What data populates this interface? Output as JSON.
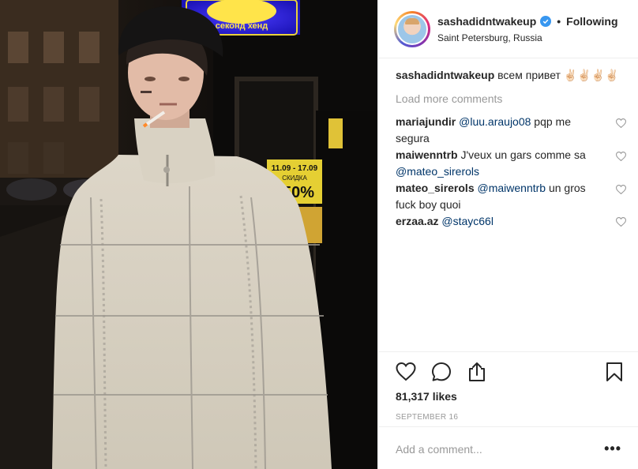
{
  "post": {
    "username": "sashadidntwakeup",
    "verified": true,
    "follow_status": "Following",
    "location": "Saint Petersburg, Russia",
    "caption_text": "всем привет",
    "caption_emojis": "✌🏻✌🏻✌🏻✌🏻",
    "load_more_label": "Load more comments",
    "comments": [
      {
        "user": "mariajundir",
        "mention": "@luu.araujo08",
        "text": " pqp me segura",
        "mention_first": true
      },
      {
        "user": "maiwenntrb",
        "mention": "@mateo_sirerols",
        "text": "J'veux un gars comme sa ",
        "mention_first": false
      },
      {
        "user": "mateo_sirerols",
        "mention": "@maiwenntrb",
        "text": " un gros fuck boy quoi",
        "mention_first": true
      },
      {
        "user": "erzaa.az",
        "mention": "@stayc66l",
        "text": "",
        "mention_first": true
      }
    ],
    "likes": "81,317 likes",
    "timestamp": "SEPTEMBER 16",
    "add_comment_placeholder": "Add a comment...",
    "more_options": "•••"
  },
  "photo": {
    "sign_text": "секонд хенд",
    "poster_top": "11.09 - 17.09",
    "poster_mid": "СКИДКА",
    "poster_big": "50%"
  },
  "icons": {
    "like": "heart-icon",
    "comment": "comment-bubble-icon",
    "share": "share-icon",
    "save": "bookmark-icon",
    "verified": "verified-badge-icon",
    "more": "more-options-icon"
  },
  "colors": {
    "verified": "#3897f0",
    "mention": "#003569",
    "muted": "#999999",
    "text": "#262626"
  }
}
